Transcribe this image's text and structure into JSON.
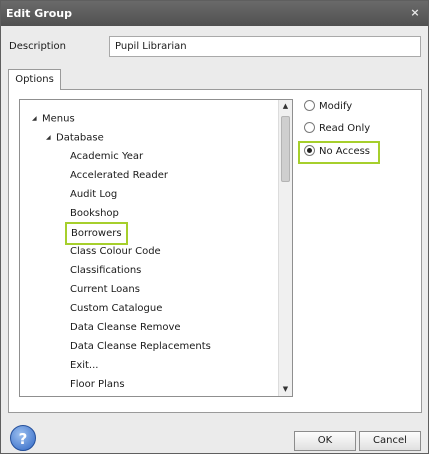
{
  "window": {
    "title": "Edit Group",
    "close_glyph": "×"
  },
  "description": {
    "label": "Description",
    "value": "Pupil Librarian"
  },
  "tabs": [
    {
      "label": "Options"
    }
  ],
  "tree": {
    "items": [
      {
        "label": "Menus",
        "expanded": true,
        "icon": "expanded-arrow-icon"
      },
      {
        "label": "Database",
        "expanded": true,
        "icon": "expanded-arrow-icon"
      },
      {
        "label": "Academic Year"
      },
      {
        "label": "Accelerated Reader"
      },
      {
        "label": "Audit Log"
      },
      {
        "label": "Bookshop"
      },
      {
        "label": "Borrowers",
        "selected": true
      },
      {
        "label": "Class Colour Code"
      },
      {
        "label": "Classifications"
      },
      {
        "label": "Current Loans"
      },
      {
        "label": "Custom Catalogue"
      },
      {
        "label": "Data Cleanse Remove"
      },
      {
        "label": "Data Cleanse Replacements"
      },
      {
        "label": "Exit..."
      },
      {
        "label": "Floor Plans"
      }
    ]
  },
  "access": {
    "options": [
      {
        "label": "Modify",
        "checked": false
      },
      {
        "label": "Read Only",
        "checked": false
      },
      {
        "label": "No Access",
        "checked": true
      }
    ]
  },
  "footer": {
    "help_glyph": "?",
    "ok_label": "OK",
    "cancel_label": "Cancel"
  },
  "colors": {
    "highlight": "#a6cf2c",
    "titlebar": "#5a5a5a",
    "help": "#2f66c4"
  }
}
